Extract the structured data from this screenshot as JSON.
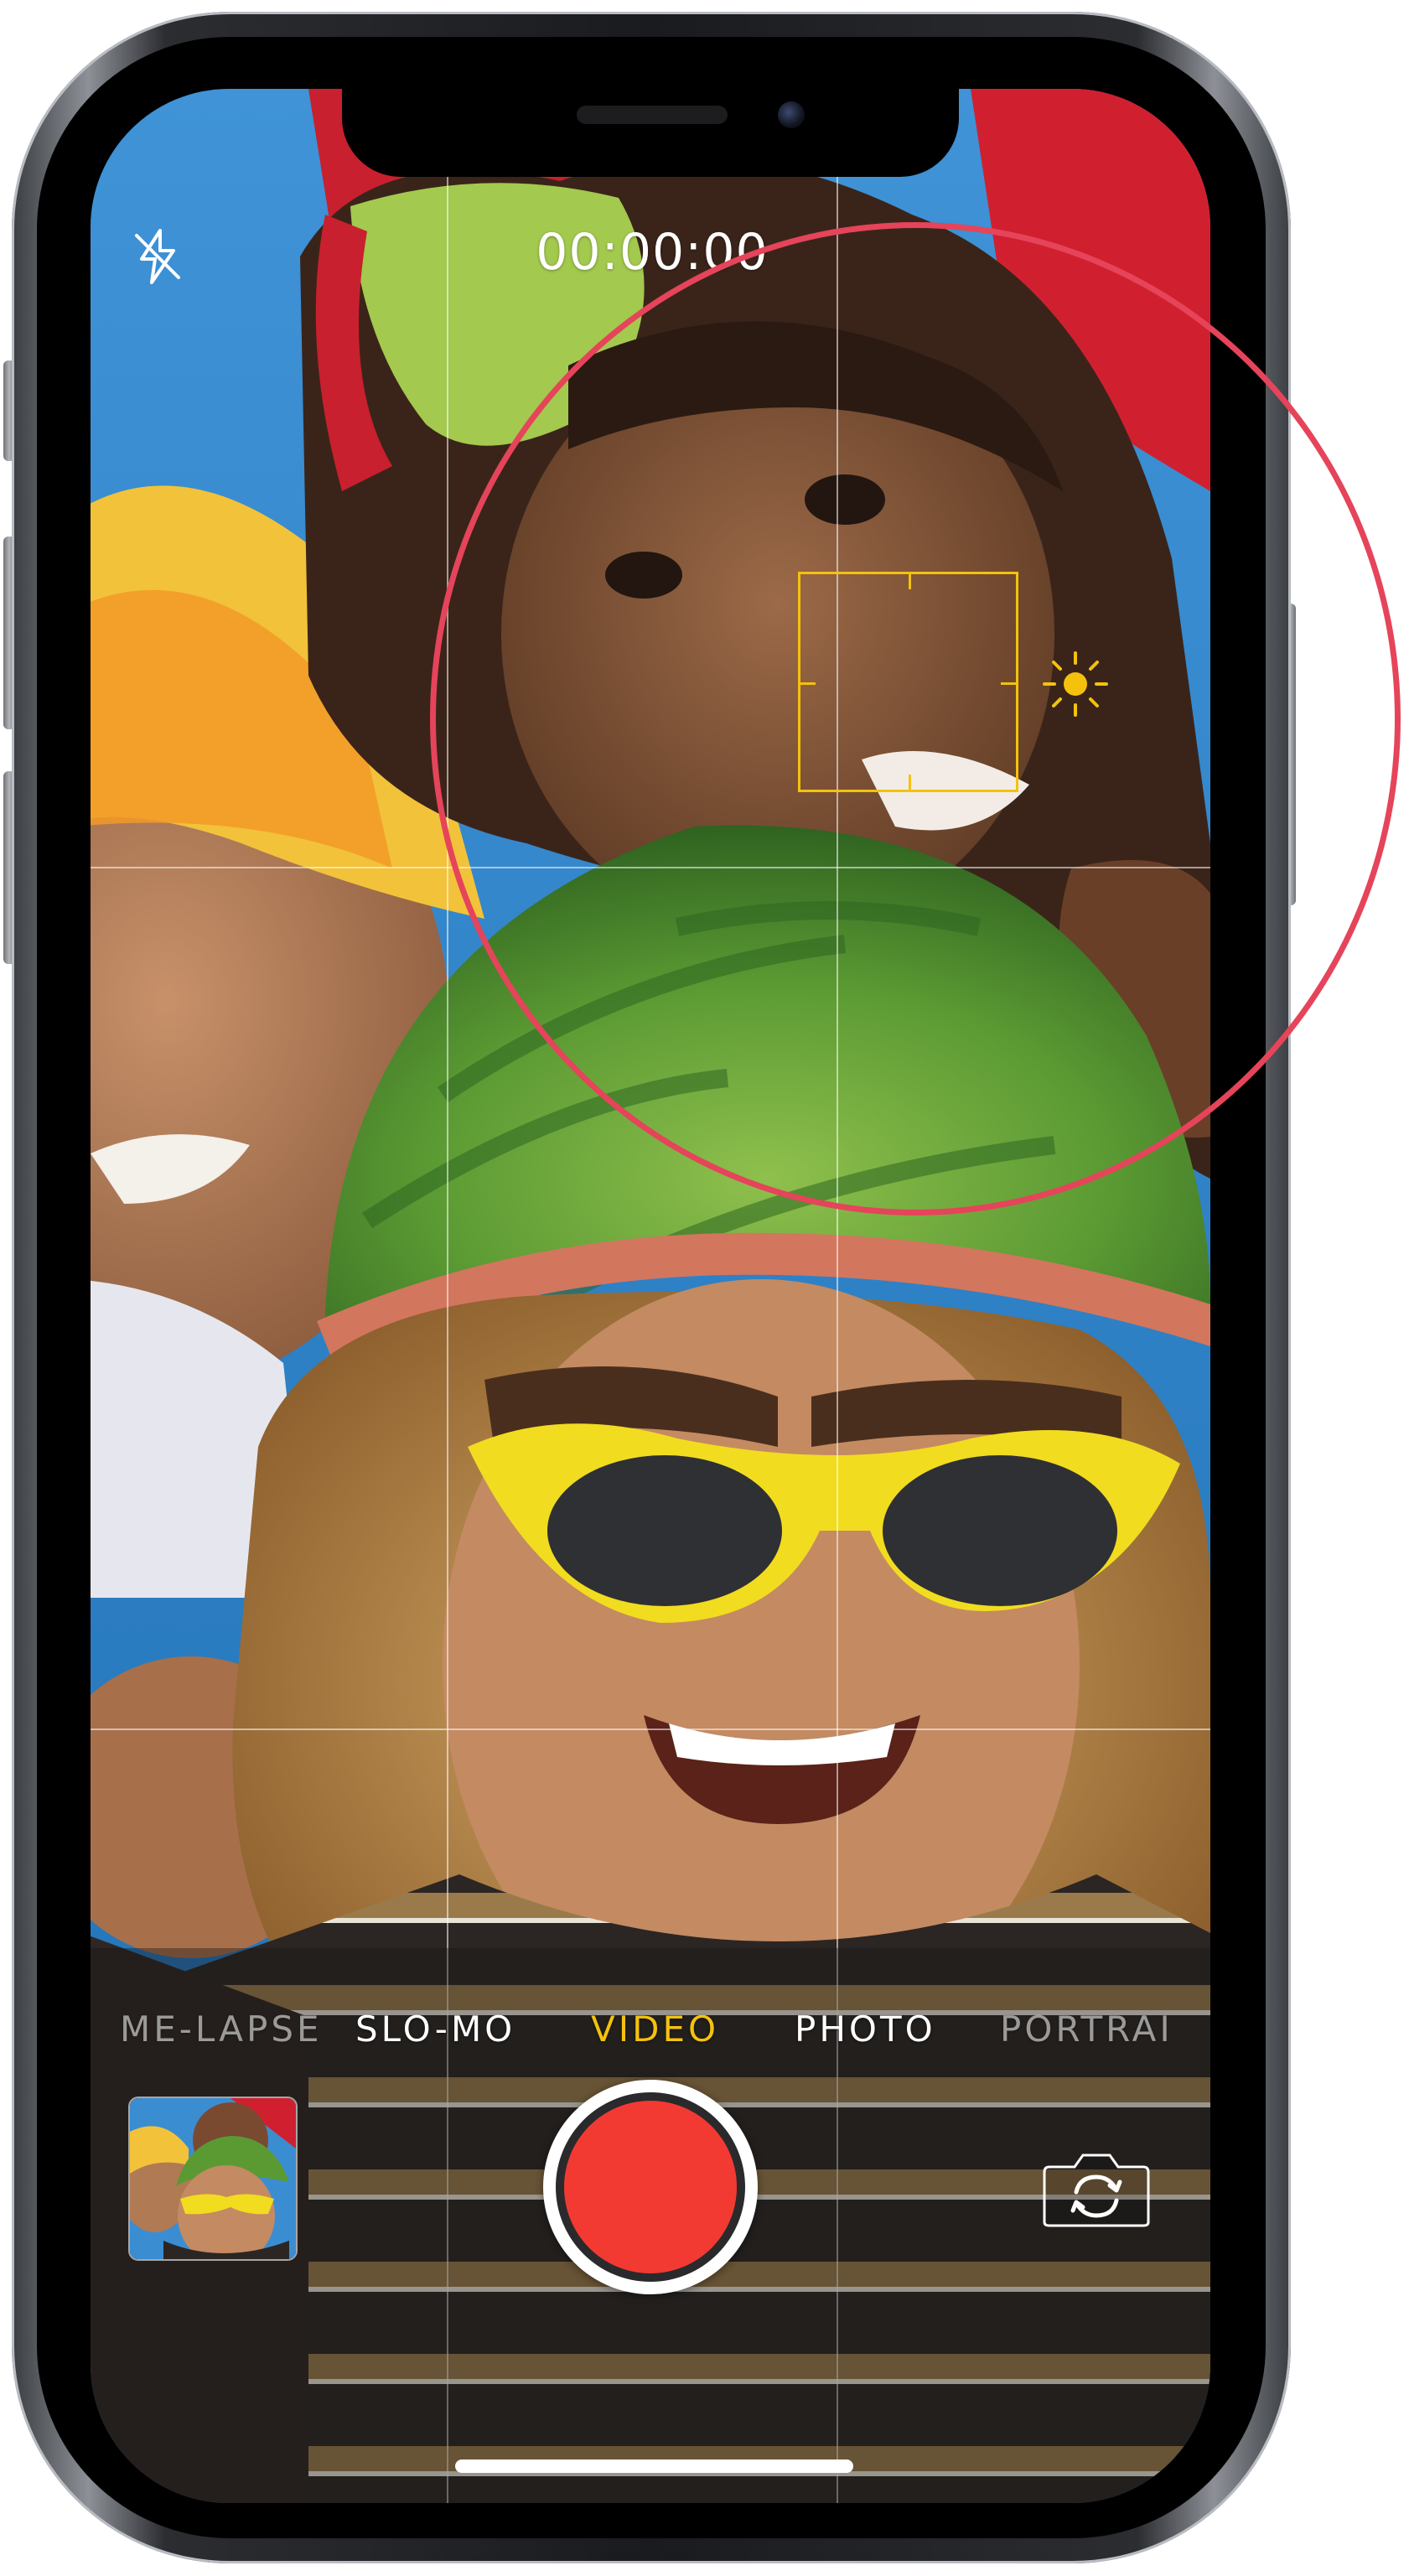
{
  "timer": {
    "text": "00:00:00"
  },
  "flash": {
    "icon": "flash-off-icon",
    "state": "off"
  },
  "modes": {
    "items": [
      {
        "label": "ME-LAPSE",
        "active": false
      },
      {
        "label": "SLO-MO",
        "active": false
      },
      {
        "label": "VIDEO",
        "active": true
      },
      {
        "label": "PHOTO",
        "active": false
      },
      {
        "label": "PORTRAI",
        "active": false
      }
    ],
    "active_color": "#f4c20d"
  },
  "shutter": {
    "icon": "record-button",
    "color": "#f23a33"
  },
  "flip": {
    "icon": "flip-camera-icon"
  },
  "focus": {
    "color": "#f4c20d",
    "exposure_icon": "sun-icon"
  },
  "highlight": {
    "color": "#e5445a"
  }
}
